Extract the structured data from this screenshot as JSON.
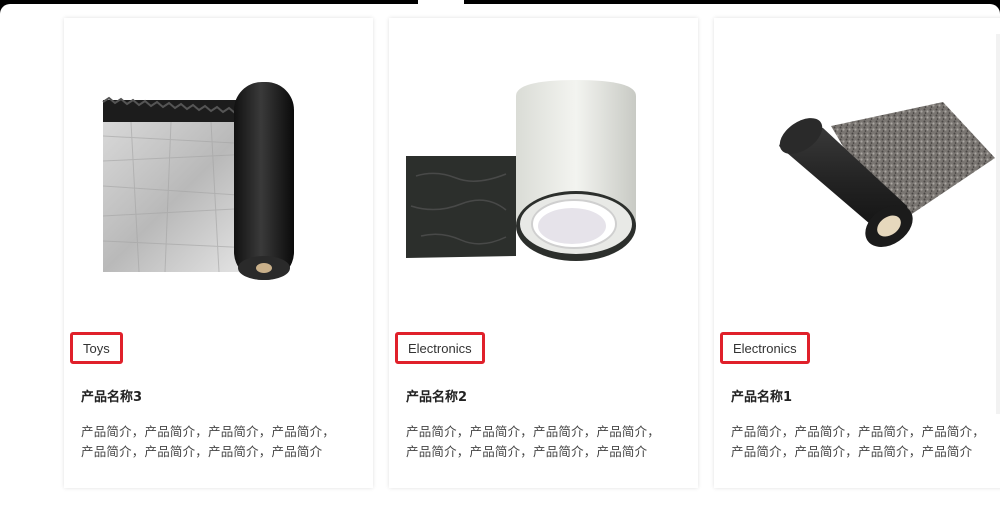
{
  "products": [
    {
      "tag": "Toys",
      "name": "产品名称3",
      "desc_line1": "产品简介，产品简介，产品简介，产品简介，",
      "desc_line2": "产品简介，产品简介，产品简介，产品简介",
      "image": "waterproof-membrane-roll-foil-icon"
    },
    {
      "tag": "Electronics",
      "name": "产品名称2",
      "desc_line1": "产品简介，产品简介，产品简介，产品简介，",
      "desc_line2": "产品简介，产品简介，产品简介，产品简介",
      "image": "waterproof-tape-roll-icon"
    },
    {
      "tag": "Electronics",
      "name": "产品名称1",
      "desc_line1": "产品简介，产品简介，产品简介，产品简介，",
      "desc_line2": "产品简介，产品简介，产品简介，产品简介",
      "image": "granular-membrane-roll-icon"
    }
  ],
  "colors": {
    "tag_border": "#e0202a",
    "card_bg": "#ffffff"
  }
}
